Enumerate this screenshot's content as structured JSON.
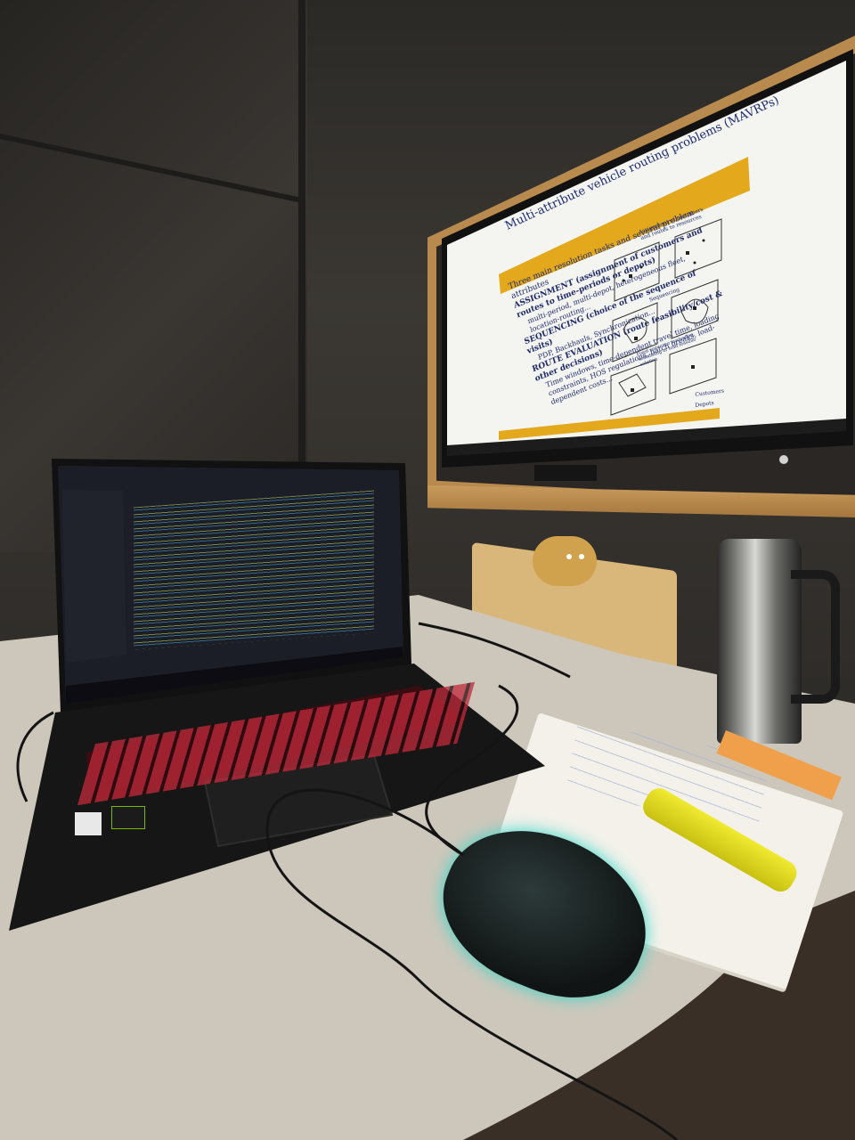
{
  "slide": {
    "title": "Multi-attribute vehicle routing problems (MAVRPs)",
    "bullets": [
      "Three main resolution tasks and several problem attributes",
      "ASSIGNMENT (assignment of customers and routes to time-periods or depots)",
      "multi-period, multi-depot, heterogeneous fleet, location-routing...",
      "SEQUENCING (choice of the sequence of visits)",
      "PDP, Backhauls, Synchronization...",
      "ROUTE EVALUATION (route feasibility/cost & other decisions)",
      "Time windows, time-dependent travel time, loading constraints, HOS regulations, batch breaks, load-dependent costs..."
    ],
    "diagram_captions": {
      "assignment": "Assignment of customers and routes to resources",
      "sequencing": "Sequencing",
      "evaluation": "Fixed sequence evaluation, scheduling or load feasible solution",
      "legend_customers": "Customers",
      "legend_depots": "Depots"
    }
  },
  "colors": {
    "wall": "#35322e",
    "desk": "#cdc7bb",
    "frame_wood": "#b98a4e",
    "slide_banner": "#e3a81c",
    "keyboard_backlight": "#c0283a",
    "mouse_glow": "#31d7c8",
    "highlighter": "#e8e21b"
  }
}
